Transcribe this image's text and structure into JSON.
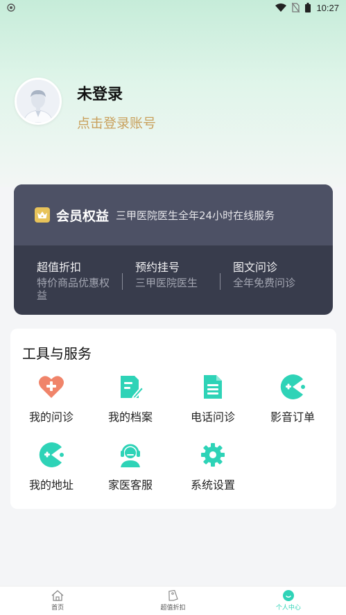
{
  "status_bar": {
    "time": "10:27"
  },
  "profile": {
    "name": "未登录",
    "login_prompt": "点击登录账号"
  },
  "member": {
    "title": "会员权益",
    "subtitle": "三甲医院医生全年24小时在线服务",
    "items": [
      {
        "title": "超值折扣",
        "desc": "特价商品优惠权益"
      },
      {
        "title": "预约挂号",
        "desc": "三甲医院医生"
      },
      {
        "title": "图文问诊",
        "desc": "全年免费问诊"
      }
    ]
  },
  "tools": {
    "title": "工具与服务",
    "items": [
      {
        "label": "我的问诊",
        "icon": "heart-plus-icon"
      },
      {
        "label": "我的档案",
        "icon": "document-edit-icon"
      },
      {
        "label": "电话问诊",
        "icon": "document-list-icon"
      },
      {
        "label": "影音订单",
        "icon": "pacman-icon"
      },
      {
        "label": "我的地址",
        "icon": "pacman-icon"
      },
      {
        "label": "家医客服",
        "icon": "headset-user-icon"
      },
      {
        "label": "系统设置",
        "icon": "gear-icon"
      }
    ]
  },
  "nav": {
    "items": [
      {
        "label": "首页",
        "icon": "home-icon"
      },
      {
        "label": "超值折扣",
        "icon": "tag-icon"
      },
      {
        "label": "个人中心",
        "icon": "profile-icon"
      }
    ],
    "active_index": 2
  },
  "colors": {
    "accent": "#2ed3b7",
    "login_link": "#c9a15d",
    "heart_icon": "#f0846a",
    "member_card": "#383c4c"
  }
}
